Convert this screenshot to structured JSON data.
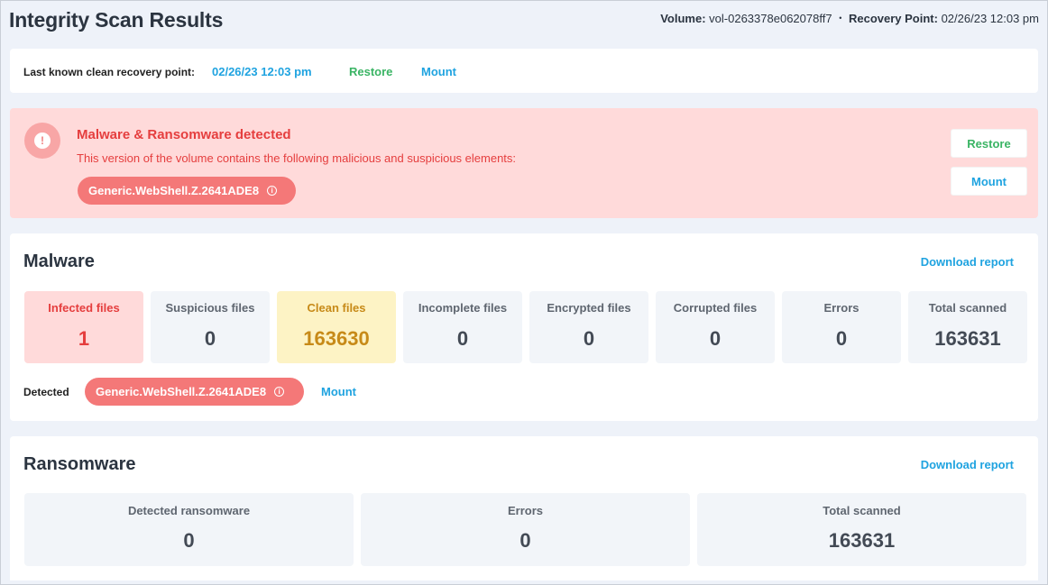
{
  "header": {
    "title": "Integrity Scan Results",
    "volume_label": "Volume:",
    "volume_value": "vol-0263378e062078ff7",
    "recovery_label": "Recovery Point:",
    "recovery_value": "02/26/23 12:03 pm"
  },
  "clean_point": {
    "label": "Last known clean recovery point:",
    "date": "02/26/23 12:03 pm",
    "restore": "Restore",
    "mount": "Mount"
  },
  "alert": {
    "icon": "exclamation-icon",
    "title": "Malware & Ransomware detected",
    "description": "This version of the volume contains the following malicious and suspicious elements:",
    "threat": "Generic.WebShell.Z.2641ADE8",
    "restore": "Restore",
    "mount": "Mount"
  },
  "malware": {
    "title": "Malware",
    "download": "Download report",
    "tiles": [
      {
        "label": "Infected files",
        "value": "1"
      },
      {
        "label": "Suspicious files",
        "value": "0"
      },
      {
        "label": "Clean files",
        "value": "163630"
      },
      {
        "label": "Incomplete files",
        "value": "0"
      },
      {
        "label": "Encrypted files",
        "value": "0"
      },
      {
        "label": "Corrupted files",
        "value": "0"
      },
      {
        "label": "Errors",
        "value": "0"
      },
      {
        "label": "Total scanned",
        "value": "163631"
      }
    ],
    "detected_label": "Detected",
    "threat": "Generic.WebShell.Z.2641ADE8",
    "mount": "Mount"
  },
  "ransomware": {
    "title": "Ransomware",
    "download": "Download report",
    "tiles": [
      {
        "label": "Detected ransomware",
        "value": "0"
      },
      {
        "label": "Errors",
        "value": "0"
      },
      {
        "label": "Total scanned",
        "value": "163631"
      }
    ]
  },
  "colors": {
    "accent_blue": "#1fa3e0",
    "accent_green": "#3ab464",
    "danger": "#e53e3e",
    "danger_bg": "#ffdada",
    "clean_bg": "#fdf3c5"
  }
}
